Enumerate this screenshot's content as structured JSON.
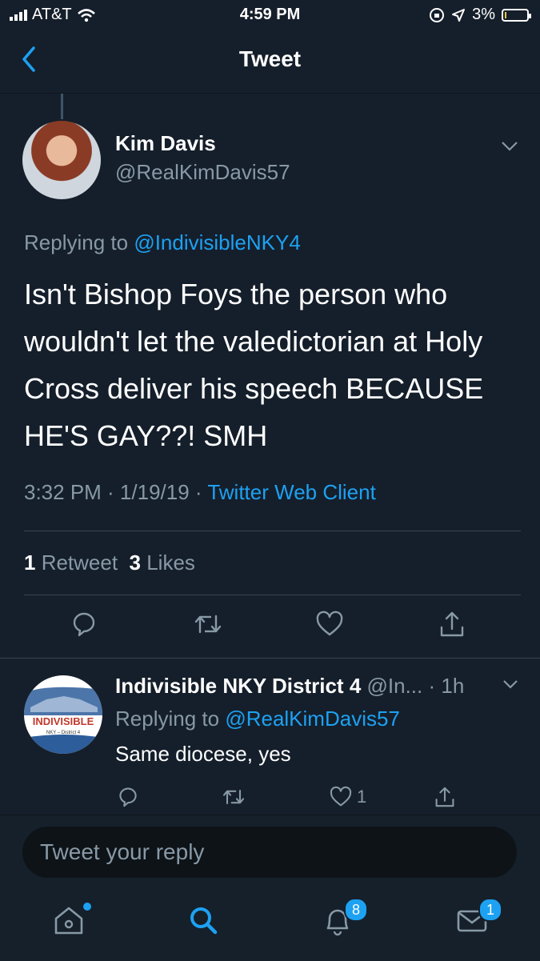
{
  "status_bar": {
    "carrier": "AT&T",
    "time": "4:59 PM",
    "battery": "3%"
  },
  "header": {
    "title": "Tweet"
  },
  "tweet": {
    "author_name": "Kim Davis",
    "author_handle": "@RealKimDavis57",
    "replying_prefix": "Replying to ",
    "replying_to": "@IndivisibleNKY4",
    "text": "Isn't Bishop Foys the person who wouldn't let the valedictorian at Holy Cross deliver his speech BECAUSE HE'S GAY??!   SMH",
    "timestamp": "3:32 PM · 1/19/19 · ",
    "client": "Twitter Web Client",
    "retweet_count": "1",
    "retweet_label": " Retweet",
    "like_count": "3",
    "like_label": " Likes"
  },
  "reply": {
    "author_name": "Indivisible NKY District 4",
    "author_handle": " @In...",
    "time": " · 1h",
    "replying_prefix": "Replying to ",
    "replying_to": "@RealKimDavis57",
    "text": "Same diocese, yes",
    "like_count": "1",
    "avatar_text": "INDIVISIBLE",
    "avatar_subtext": "NKY – District 4"
  },
  "compose": {
    "placeholder": "Tweet your reply"
  },
  "tabbar": {
    "notifications_badge": "8",
    "messages_badge": "1"
  },
  "colors": {
    "background": "#151f2b",
    "accent": "#1da1f2",
    "muted": "#8899a6"
  }
}
